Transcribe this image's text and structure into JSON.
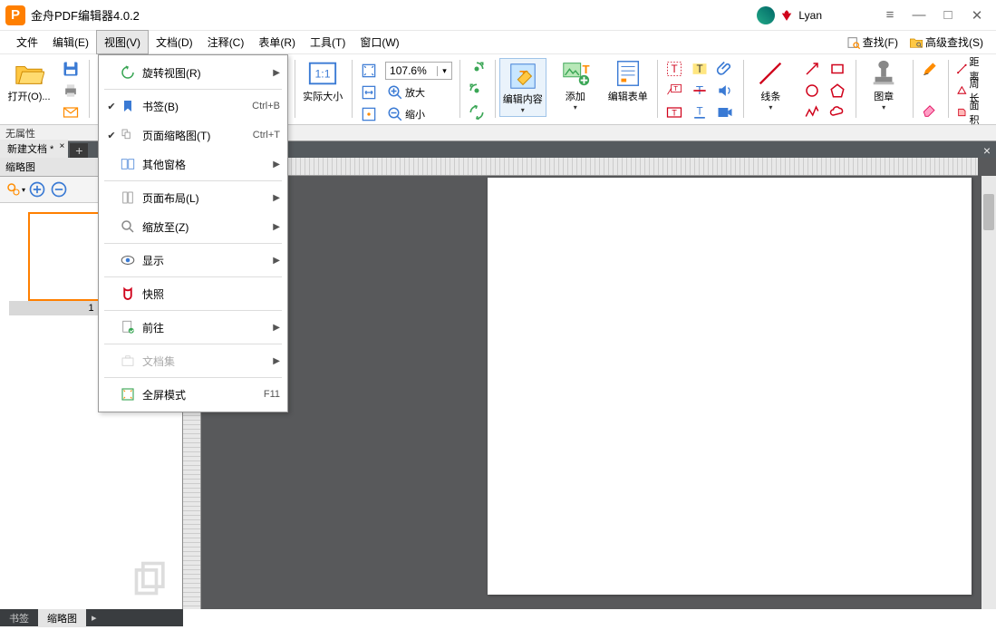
{
  "title_bar": {
    "app_name": "金舟PDF编辑器4.0.2",
    "username": "Lyan"
  },
  "menu": {
    "items": [
      "文件",
      "编辑(E)",
      "视图(V)",
      "文档(D)",
      "注释(C)",
      "表单(R)",
      "工具(T)",
      "窗口(W)"
    ],
    "search1_label": "查找(F)",
    "search2_label": "高级查找(S)"
  },
  "toolbar": {
    "open_label": "打开(O)...",
    "actual_size_label": "实际大小",
    "zoom_value": "107.6%",
    "zoom_in_label": "放大",
    "zoom_out_label": "缩小",
    "edit_content_label": "编辑内容",
    "edit_content_drop": "▾",
    "add_label": "添加",
    "add_drop": "▾",
    "edit_form_label": "编辑表单",
    "lines_label": "线条",
    "lines_drop": "▾",
    "stamp_label": "图章",
    "stamp_drop": "▾",
    "distance_label": "距离",
    "perimeter_label": "周长",
    "area_label": "面积"
  },
  "props_bar": {
    "label": "无属性"
  },
  "tabs": {
    "doc_name": "新建文档 *"
  },
  "sidebar": {
    "title": "缩略图",
    "page_number": "1"
  },
  "bottom_tabs": {
    "bookmark": "书签",
    "thumbnail": "缩略图"
  },
  "dropdown": {
    "rotate_view": "旋转视图(R)",
    "bookmark": "书签(B)",
    "bookmark_sc": "Ctrl+B",
    "thumb": "页面缩略图(T)",
    "thumb_sc": "Ctrl+T",
    "other_panes": "其他窗格",
    "page_layout": "页面布局(L)",
    "zoom_to": "缩放至(Z)",
    "display": "显示",
    "snapshot": "快照",
    "goto": "前往",
    "portfolio": "文档集",
    "fullscreen": "全屏模式",
    "fullscreen_sc": "F11"
  }
}
